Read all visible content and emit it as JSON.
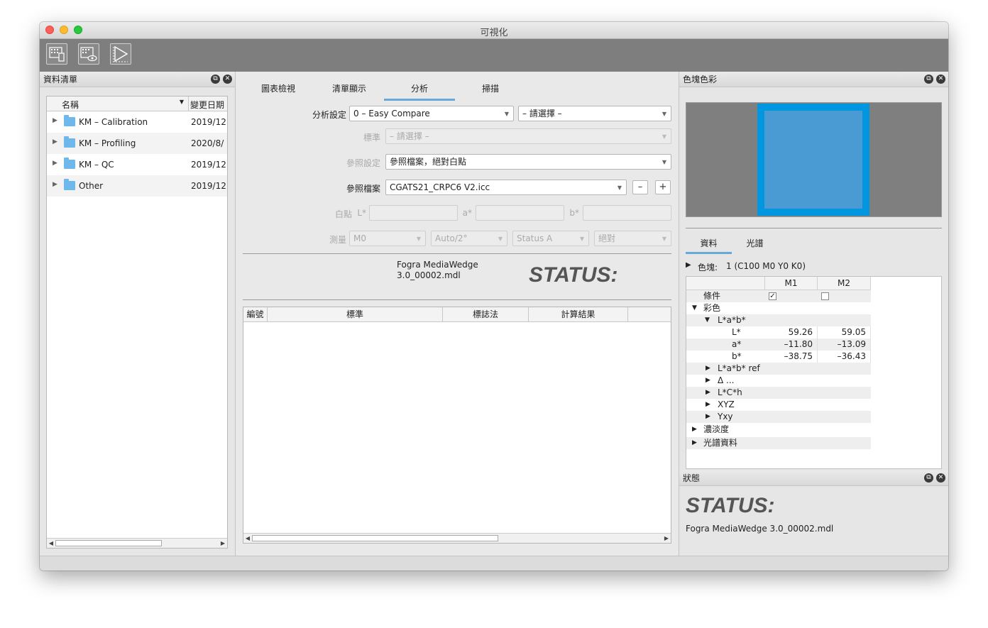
{
  "window": {
    "title": "可視化"
  },
  "toolbar": {
    "buttons": [
      {
        "icon": "grid-device-icon"
      },
      {
        "icon": "grid-eye-icon"
      },
      {
        "icon": "triangle-chart-icon"
      }
    ]
  },
  "left_panel": {
    "title": "資料清單",
    "columns": {
      "name": "名稱",
      "date": "變更日期"
    },
    "rows": [
      {
        "name": "KM – Calibration",
        "date": "2019/12"
      },
      {
        "name": "KM – Profiling",
        "date": "2020/8/"
      },
      {
        "name": "KM – QC",
        "date": "2019/12"
      },
      {
        "name": "Other",
        "date": "2019/12"
      }
    ]
  },
  "center": {
    "tabs": [
      "圖表檢視",
      "清單顯示",
      "分析",
      "掃描"
    ],
    "active_tab": "分析",
    "analysis_setting": {
      "label": "分析設定",
      "value": "0 – Easy Compare",
      "secondary": "– 請選擇 –"
    },
    "standard": {
      "label": "標準",
      "value": "– 請選擇 –"
    },
    "reference_setting": {
      "label": "參照設定",
      "value": "參照檔案，絕對白點"
    },
    "reference_file": {
      "label": "參照檔案",
      "value": "CGATS21_CRPC6 V2.icc",
      "minus": "–",
      "plus": "+"
    },
    "white_point": {
      "label": "白點",
      "l": "L*",
      "a": "a*",
      "b": "b*"
    },
    "measurement": {
      "label": "測量",
      "mode": "M0",
      "observer": "Auto/2°",
      "status": "Status A",
      "mode2": "絕對"
    },
    "wedge": {
      "line1": "Fogra MediaWedge",
      "line2": "3.0_00002.mdl"
    },
    "status_word": "STATUS:",
    "table_columns": [
      "編號",
      "標準",
      "標誌法",
      "計算結果"
    ]
  },
  "right_panel": {
    "title": "色塊色彩",
    "swatch": {
      "outer": "#0096e0",
      "inner": "#4a9ad4",
      "bg": "#7f7f7f"
    },
    "tabs": [
      "資料",
      "光譜"
    ],
    "active_tab": "資料",
    "patch": {
      "label": "色塊:",
      "value": "1 (C100 M0 Y0 K0)"
    },
    "col_headers": [
      "M1",
      "M2"
    ],
    "rows": [
      {
        "label": "條件",
        "m1": "✓",
        "m2": ""
      },
      {
        "label": "彩色",
        "m1": "",
        "m2": ""
      },
      {
        "label": "L*a*b*",
        "m1": "",
        "m2": ""
      },
      {
        "label": "L*",
        "m1": "59.26",
        "m2": "59.05"
      },
      {
        "label": "a*",
        "m1": "–11.80",
        "m2": "–13.09"
      },
      {
        "label": "b*",
        "m1": "–38.75",
        "m2": "–36.43"
      },
      {
        "label": "L*a*b* ref",
        "m1": "",
        "m2": ""
      },
      {
        "label": "Δ ...",
        "m1": "",
        "m2": ""
      },
      {
        "label": "L*C*h",
        "m1": "",
        "m2": ""
      },
      {
        "label": "XYZ",
        "m1": "",
        "m2": ""
      },
      {
        "label": "Yxy",
        "m1": "",
        "m2": ""
      },
      {
        "label": "濃淡度",
        "m1": "",
        "m2": ""
      },
      {
        "label": "光譜資料",
        "m1": "",
        "m2": ""
      }
    ]
  },
  "status_panel": {
    "title": "狀態",
    "status_word": "STATUS:",
    "file": "Fogra MediaWedge 3.0_00002.mdl"
  }
}
